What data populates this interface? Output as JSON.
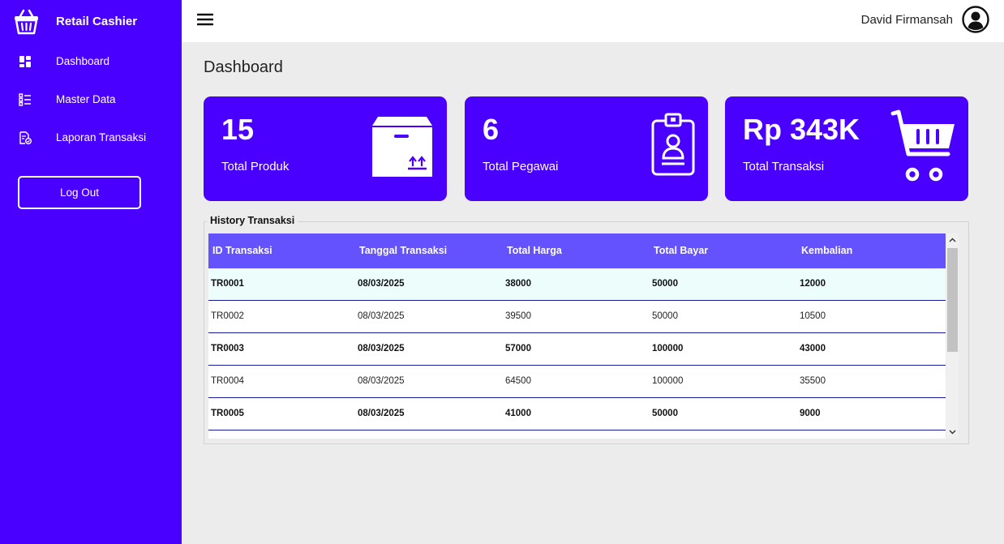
{
  "sidebar": {
    "app_title": "Retail Cashier",
    "items": [
      {
        "label": "Dashboard",
        "icon": "dashboard-icon"
      },
      {
        "label": "Master Data",
        "icon": "list-icon"
      },
      {
        "label": "Laporan Transaksi",
        "icon": "report-icon"
      }
    ],
    "logout_label": "Log Out"
  },
  "header": {
    "user_name": "David Firmansah"
  },
  "main": {
    "page_title": "Dashboard",
    "cards": [
      {
        "value": "15",
        "label": "Total Produk",
        "icon": "box-icon"
      },
      {
        "value": "6",
        "label": "Total Pegawai",
        "icon": "id-badge-icon"
      },
      {
        "value": "Rp 343K",
        "label": "Total Transaksi",
        "icon": "shopping-cart-icon"
      }
    ],
    "history": {
      "title": "History Transaksi",
      "columns": [
        "ID Transaksi",
        "Tanggal Transaksi",
        "Total Harga",
        "Total Bayar",
        "Kembalian"
      ],
      "rows": [
        [
          "TR0001",
          "08/03/2025",
          "38000",
          "50000",
          "12000"
        ],
        [
          "TR0002",
          "08/03/2025",
          "39500",
          "50000",
          "10500"
        ],
        [
          "TR0003",
          "08/03/2025",
          "57000",
          "100000",
          "43000"
        ],
        [
          "TR0004",
          "08/03/2025",
          "64500",
          "100000",
          "35500"
        ],
        [
          "TR0005",
          "08/03/2025",
          "41000",
          "50000",
          "9000"
        ]
      ]
    }
  },
  "colors": {
    "primary": "#4a00ff",
    "table_header": "#6452ff",
    "selected_row": "#ecfdfc",
    "background": "#ececec"
  }
}
